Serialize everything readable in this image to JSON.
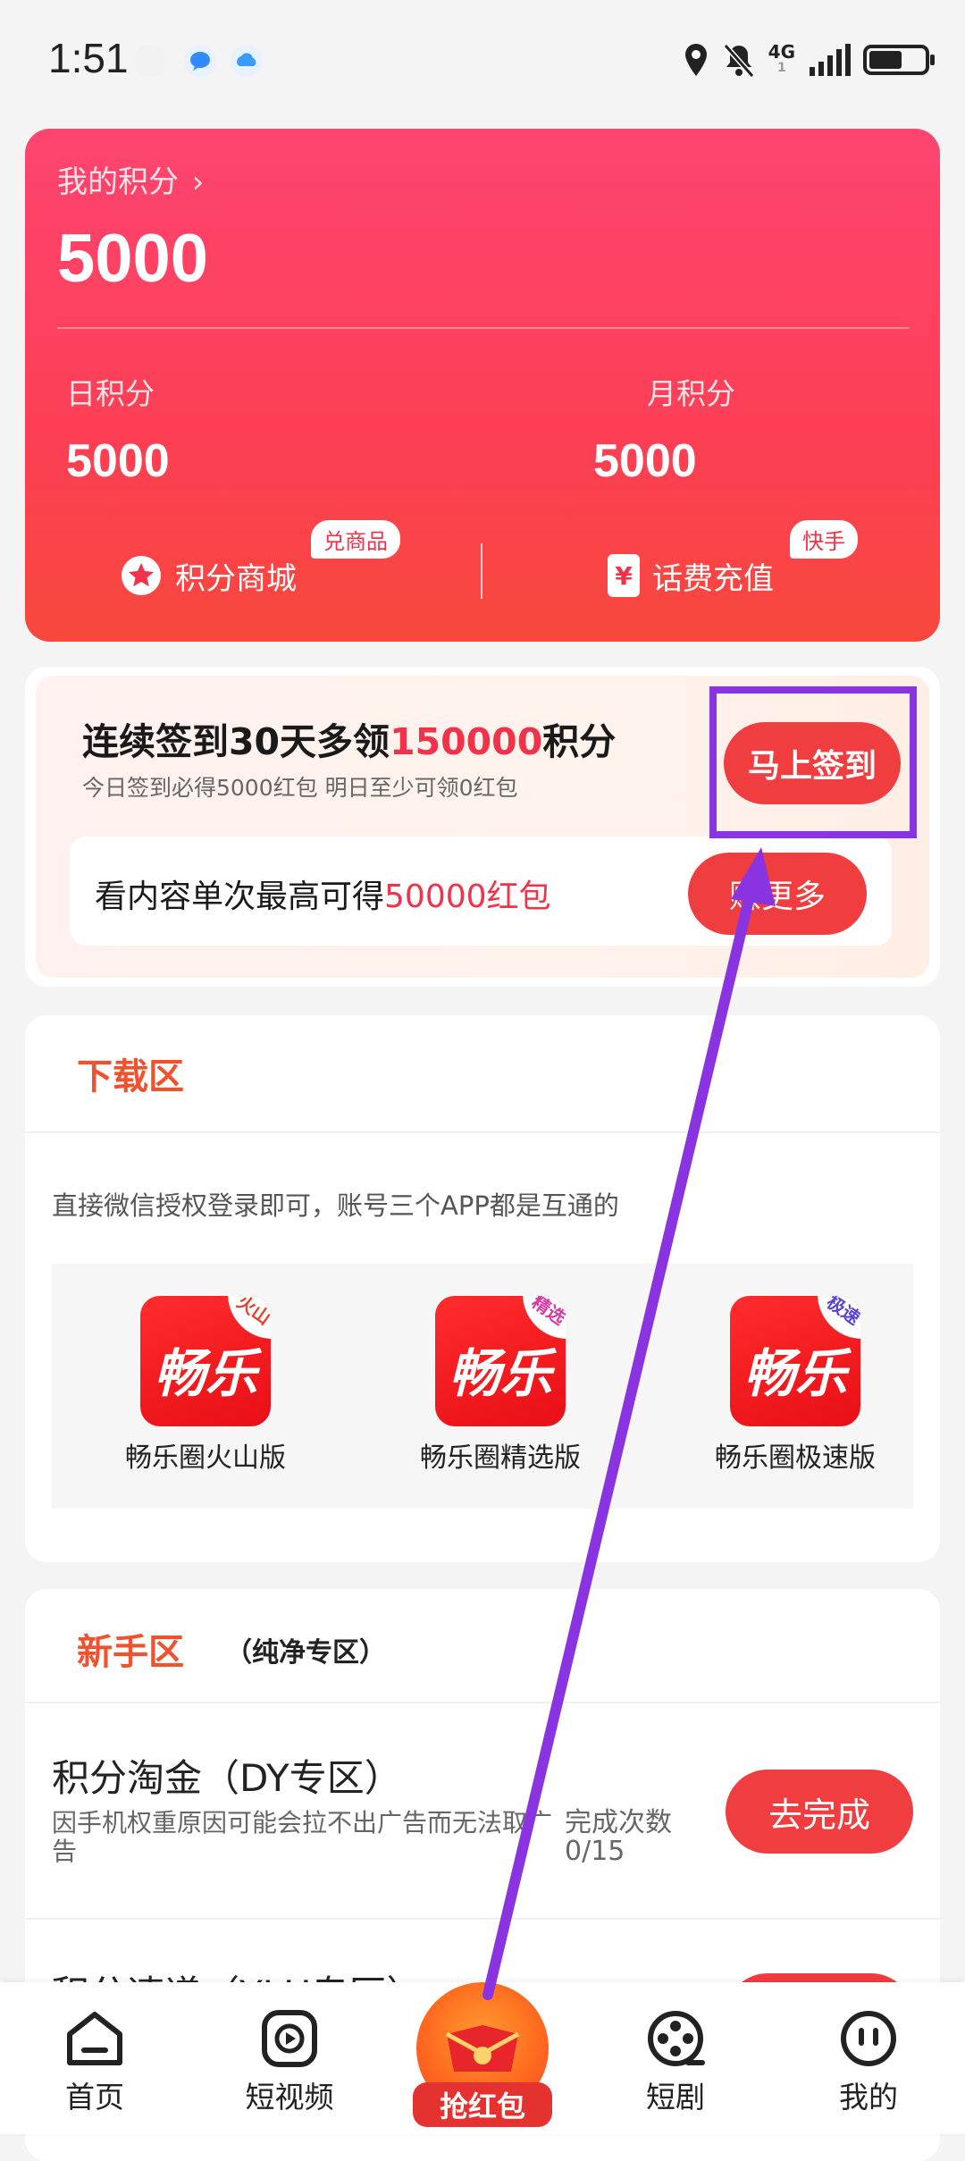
{
  "status_bar": {
    "time": "1:51",
    "network": "4G",
    "network_sub": "1",
    "battery_percent": 60,
    "icons": [
      "huawei-app-icon",
      "message-bubble-icon",
      "cloud-icon",
      "location-icon",
      "mute-bell-icon",
      "signal-icon",
      "battery-icon"
    ]
  },
  "points_card": {
    "title": "我的积分",
    "total": "5000",
    "daily_label": "日积分",
    "daily_value": "5000",
    "monthly_label": "月积分",
    "monthly_value": "5000",
    "mall_label": "积分商城",
    "mall_tag": "兑商品",
    "recharge_label": "话费充值",
    "recharge_tag": "快手",
    "recharge_icon_glyph": "¥"
  },
  "sign_in": {
    "headline_prefix": "连续签到30天多领",
    "headline_highlight": "150000",
    "headline_suffix": "积分",
    "subtext": "今日签到必得5000红包 明日至少可领0红包",
    "button": "马上签到",
    "watch_prefix": "看内容单次最高可得",
    "watch_highlight": "50000红包",
    "watch_button": "赚更多"
  },
  "download": {
    "title": "下载区",
    "note": "直接微信授权登录即可，账号三个APP都是互通的",
    "apps": [
      {
        "name": "畅乐圈火山版",
        "icon_text": "畅乐",
        "corner": "火山",
        "corner_color": "#e8402a"
      },
      {
        "name": "畅乐圈精选版",
        "icon_text": "畅乐",
        "corner": "精选",
        "corner_color": "#d63aa4"
      },
      {
        "name": "畅乐圈极速版",
        "icon_text": "畅乐",
        "corner": "极速",
        "corner_color": "#5b43d6"
      }
    ]
  },
  "newbie": {
    "title": "新手区",
    "subtitle": "（纯净专区）",
    "tasks": [
      {
        "title": "积分淘金（DY专区）",
        "desc": "因手机权重原因可能会拉不出广告而无法取广告",
        "count_label": "完成次数",
        "count_value": "0/15",
        "button": "去完成"
      },
      {
        "title": "积分速递（YLH专区）",
        "button": ""
      }
    ]
  },
  "bottom_nav": {
    "items": [
      {
        "label": "首页",
        "icon": "home-icon"
      },
      {
        "label": "短视频",
        "icon": "play-icon"
      },
      {
        "label": "抢红包",
        "icon": "red-packet-icon"
      },
      {
        "label": "短剧",
        "icon": "film-reel-icon"
      },
      {
        "label": "我的",
        "icon": "profile-face-icon"
      }
    ]
  },
  "colors": {
    "accent_red": "#f03d40",
    "section_orange": "#f0522d",
    "annotation_purple": "#8a33e0"
  }
}
